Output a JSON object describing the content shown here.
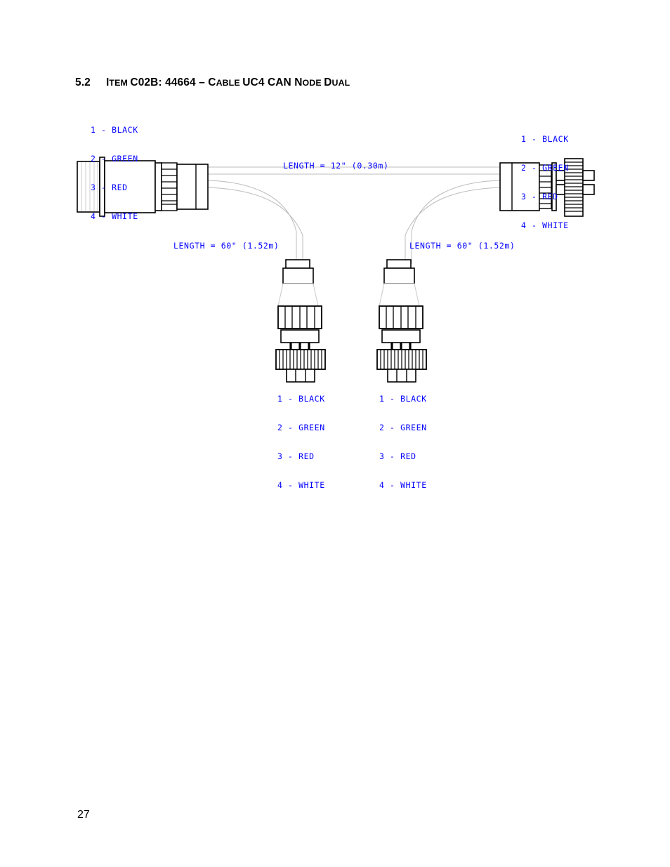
{
  "document": {
    "page_number": "27"
  },
  "heading": {
    "number": "5.2",
    "text": "Item C02B: 44664 – Cable UC4 CAN Node Dual",
    "parts": [
      {
        "text": "I",
        "small": false
      },
      {
        "text": "TEM ",
        "small": true
      },
      {
        "text": "C02B: 44664 – ",
        "small": false
      },
      {
        "text": "C",
        "small": false
      },
      {
        "text": "ABLE ",
        "small": true
      },
      {
        "text": "UC4 CAN ",
        "small": false
      },
      {
        "text": "N",
        "small": false
      },
      {
        "text": "ODE ",
        "small": true
      },
      {
        "text": "D",
        "small": false
      },
      {
        "text": "UAL",
        "small": true
      }
    ]
  },
  "diagram": {
    "title": "Cable UC4 CAN Node Dual wiring diagram",
    "annotation_color": "#0000ff",
    "line_color": "#000000",
    "cable_color": "#b0b0b0",
    "wire_lists": [
      {
        "id": "top-left",
        "rows": [
          "1 - BLACK",
          "2 - GREEN",
          "3 - RED",
          "4 - WHITE"
        ]
      },
      {
        "id": "top-right",
        "rows": [
          "1 - BLACK",
          "2 - GREEN",
          "3 - RED",
          "4 - WHITE"
        ]
      },
      {
        "id": "bottom-left",
        "rows": [
          "1 - BLACK",
          "2 - GREEN",
          "3 - RED",
          "4 - WHITE"
        ]
      },
      {
        "id": "bottom-right",
        "rows": [
          "1 - BLACK",
          "2 - GREEN",
          "3 - RED",
          "4 - WHITE"
        ]
      }
    ],
    "length_labels": [
      {
        "id": "trunk",
        "text": "LENGTH = 12\" (0.30m)"
      },
      {
        "id": "branch-left",
        "text": "LENGTH = 60\" (1.52m)"
      },
      {
        "id": "branch-right",
        "text": "LENGTH = 60\" (1.52m)"
      }
    ],
    "connectors": [
      {
        "id": "left-bulkhead",
        "label": "bulkhead connector with hatched flange"
      },
      {
        "id": "right-inline",
        "label": "inline knurled coupling connector"
      },
      {
        "id": "bottom-left-node",
        "label": "node drop connector"
      },
      {
        "id": "bottom-right-node",
        "label": "node drop connector"
      }
    ]
  }
}
